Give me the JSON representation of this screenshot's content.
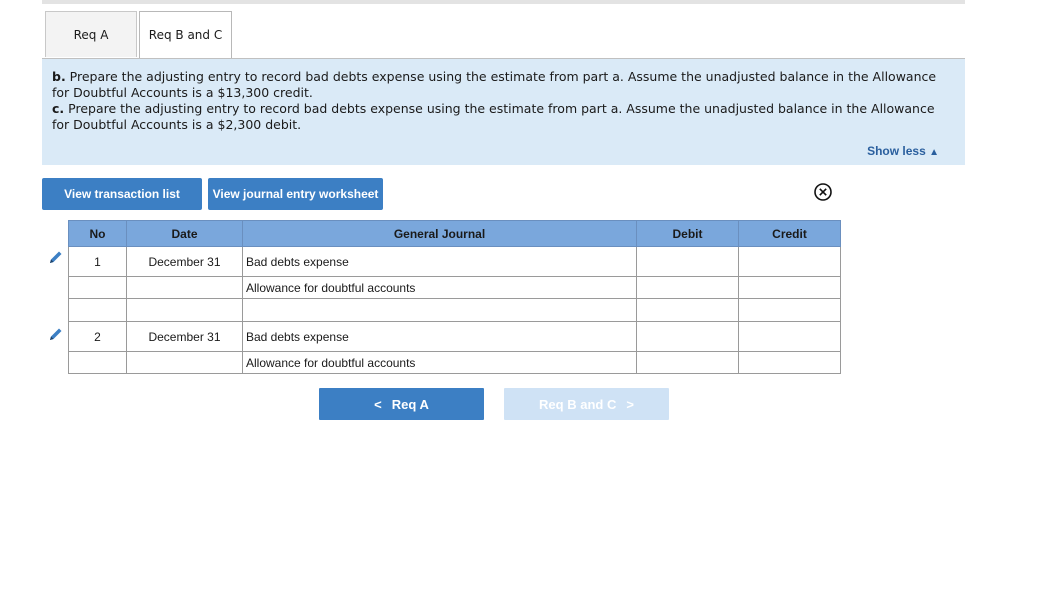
{
  "tabs": [
    {
      "label": "Req A",
      "active": false
    },
    {
      "label": "Req B and C",
      "active": true
    }
  ],
  "instructions": {
    "b_prefix": "b.",
    "b_text": " Prepare the adjusting entry to record bad debts expense using the estimate from part a. Assume the unadjusted balance in the Allowance for Doubtful Accounts is a $13,300 credit.",
    "c_prefix": "c.",
    "c_text": " Prepare the adjusting entry to record bad debts expense using the estimate from part a. Assume the unadjusted balance in the Allowance for Doubtful Accounts is a $2,300 debit.",
    "show_less": "Show less"
  },
  "buttons": {
    "view_transaction_list": "View transaction list",
    "view_journal_entry_worksheet": "View journal entry worksheet"
  },
  "journal": {
    "headers": {
      "no": "No",
      "date": "Date",
      "general_journal": "General Journal",
      "debit": "Debit",
      "credit": "Credit"
    },
    "entries": [
      {
        "no": "1",
        "date": "December 31",
        "debit_account": "Bad debts expense",
        "credit_account": "Allowance for doubtful accounts"
      },
      {
        "no": "2",
        "date": "December 31",
        "debit_account": "Bad debts expense",
        "credit_account": "Allowance for doubtful accounts"
      }
    ]
  },
  "nav": {
    "prev_label": "Req A",
    "next_label": "Req B and C"
  },
  "colors": {
    "accent": "#3c7fc4",
    "header_bg": "#7aa7dc",
    "instructions_bg": "#daeaf7"
  },
  "icons": {
    "edit": "pencil-icon",
    "close": "close-circle-icon",
    "show_less": "triangle-up-icon",
    "prev": "chevron-left-icon",
    "next": "chevron-right-icon"
  }
}
